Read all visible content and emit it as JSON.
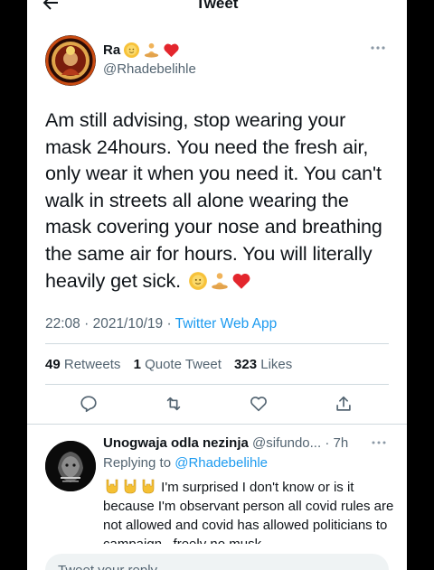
{
  "header": {
    "title": "Tweet",
    "back_icon": "arrow-left-icon"
  },
  "tweet": {
    "author": {
      "display_name": "Ra",
      "name_emojis": [
        "sun-face-emoji",
        "person-lotus-emoji",
        "red-heart-emoji"
      ],
      "handle": "@Rhadebelihle"
    },
    "text": "Am still advising, stop wearing your mask 24hours. You need the fresh air, only wear it when you need it. You can't walk in streets all alone wearing the mask covering your nose and breathing the same air for hours. You will literally heavily get sick.",
    "text_emojis": [
      "sun-face-emoji",
      "person-lotus-emoji",
      "red-heart-emoji"
    ],
    "time": "22:08",
    "date": "2021/10/19",
    "source": "Twitter Web App",
    "stats": {
      "retweets_count": "49",
      "retweets_label": "Retweets",
      "quotes_count": "1",
      "quotes_label": "Quote Tweet",
      "likes_count": "323",
      "likes_label": "Likes"
    },
    "actions": [
      "reply-icon",
      "retweet-icon",
      "like-icon",
      "share-icon"
    ]
  },
  "reply": {
    "display_name": "Unogwaja odla nezinja",
    "handle": "@sifundo...",
    "time": "· 7h",
    "replying_prefix": "Replying to",
    "replying_to": "@Rhadebelihle",
    "text_emojis": [
      "sign-of-horns-emoji",
      "sign-of-horns-emoji",
      "sign-of-horns-emoji"
    ],
    "text": "I'm surprised I don't know or is it because  I'm observant person all covid rules are not allowed and covid has allowed politicians to campaign , freely no musk"
  },
  "composer": {
    "placeholder": "Tweet your reply"
  },
  "colors": {
    "accent": "#1d9bf0",
    "text": "#0f1419",
    "secondary_text": "#536471",
    "divider": "#cfd9de"
  }
}
